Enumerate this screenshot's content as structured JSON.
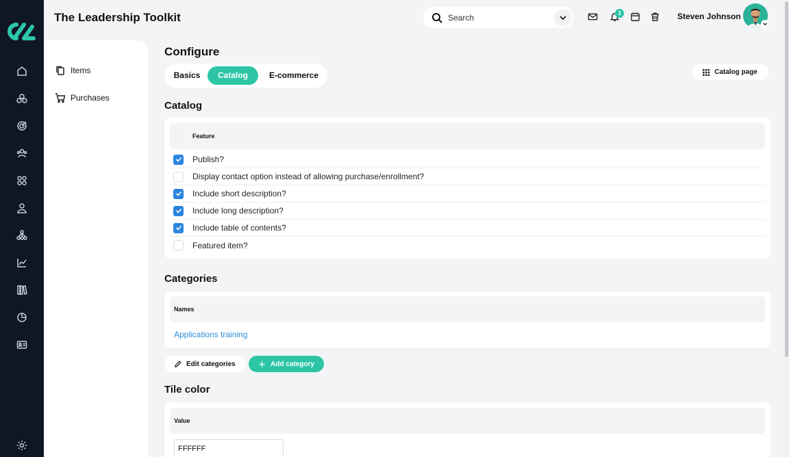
{
  "app": {
    "title": "The Leadership Toolkit"
  },
  "header": {
    "search_placeholder": "Search",
    "notifications_count": "3",
    "user_name": "Steven Johnson"
  },
  "rail": {
    "icons": [
      "home-icon",
      "modules-icon",
      "target-icon",
      "users-icon",
      "grid-icon",
      "person-icon",
      "hierarchy-icon",
      "chart-icon",
      "library-icon",
      "pie-chart-icon",
      "id-card-icon",
      "settings-icon"
    ]
  },
  "subnav": {
    "items": [
      {
        "label": "Items",
        "icon": "copy-icon"
      },
      {
        "label": "Purchases",
        "icon": "cart-icon"
      }
    ]
  },
  "main": {
    "title": "Configure",
    "tabs": [
      {
        "label": "Basics",
        "active": false
      },
      {
        "label": "Catalog",
        "active": true
      },
      {
        "label": "E-commerce",
        "active": false
      }
    ],
    "catalog_page_label": "Catalog page",
    "accent_color": "#2cc6a6",
    "checkbox_color": "#2b85e0"
  },
  "catalog": {
    "title": "Catalog",
    "column_header": "Feature",
    "features": [
      {
        "label": "Publish?",
        "checked": true
      },
      {
        "label": "Display contact option instead of allowing purchase/enrollment?",
        "checked": false
      },
      {
        "label": "Include short description?",
        "checked": true
      },
      {
        "label": "Include long description?",
        "checked": true
      },
      {
        "label": "Include table of contents?",
        "checked": true
      },
      {
        "label": "Featured item?",
        "checked": false
      }
    ]
  },
  "categories": {
    "title": "Categories",
    "column_header": "Names",
    "items": [
      "Applications training"
    ],
    "edit_label": "Edit categories",
    "add_label": "Add category"
  },
  "tile_color": {
    "title": "Tile color",
    "column_header": "Value",
    "value": "FFFFFF"
  }
}
